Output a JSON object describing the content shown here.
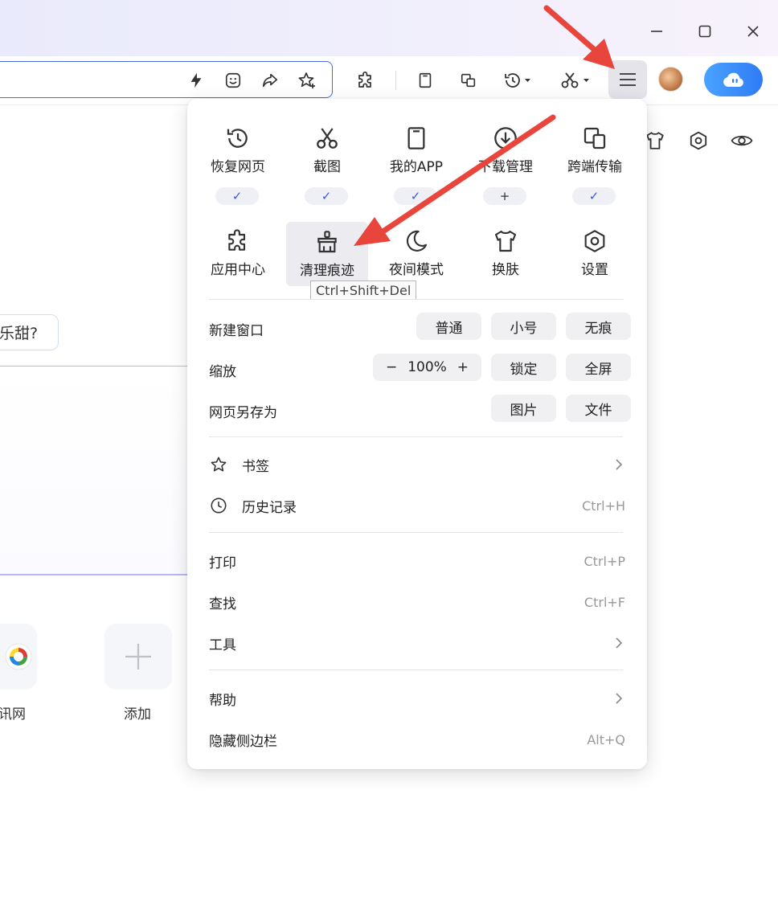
{
  "page": {
    "pill_text": "乐甜?",
    "tiles": [
      {
        "label": "讯网"
      },
      {
        "label": "添加"
      }
    ]
  },
  "menu": {
    "grid": [
      {
        "label": "恢复网页",
        "icon": "history-icon",
        "badge": "✓"
      },
      {
        "label": "截图",
        "icon": "scissors-icon",
        "badge": "✓"
      },
      {
        "label": "我的APP",
        "icon": "tablet-icon",
        "badge": "✓"
      },
      {
        "label": "下载管理",
        "icon": "download-icon",
        "badge": "+"
      },
      {
        "label": "跨端传输",
        "icon": "devices-icon",
        "badge": "✓"
      },
      {
        "label": "应用中心",
        "icon": "puzzle-icon"
      },
      {
        "label": "清理痕迹",
        "icon": "broom-icon"
      },
      {
        "label": "夜间模式",
        "icon": "moon-icon"
      },
      {
        "label": "换肤",
        "icon": "tshirt-icon"
      },
      {
        "label": "设置",
        "icon": "settings-icon"
      }
    ],
    "tooltip": "Ctrl+Shift+Del",
    "new_window": {
      "label": "新建窗口",
      "options": [
        "普通",
        "小号",
        "无痕"
      ]
    },
    "zoom": {
      "label": "缩放",
      "minus": "−",
      "value": "100%",
      "plus": "+",
      "lock": "锁定",
      "fullscreen": "全屏"
    },
    "save_as": {
      "label": "网页另存为",
      "options": [
        "图片",
        "文件"
      ]
    },
    "items": [
      {
        "label": "书签",
        "icon": "star-icon",
        "trailing": "chevron"
      },
      {
        "label": "历史记录",
        "icon": "clock-icon",
        "shortcut": "Ctrl+H"
      },
      {
        "label": "打印",
        "shortcut": "Ctrl+P"
      },
      {
        "label": "查找",
        "shortcut": "Ctrl+F"
      },
      {
        "label": "工具",
        "trailing": "chevron"
      },
      {
        "label": "帮助",
        "trailing": "chevron"
      },
      {
        "label": "隐藏侧边栏",
        "shortcut": "Alt+Q"
      }
    ]
  },
  "colors": {
    "accent": "#3b5bdb",
    "arrow": "#e8453c",
    "address_border": "#4a68e8",
    "cloud_button": "#2f7bf5"
  }
}
